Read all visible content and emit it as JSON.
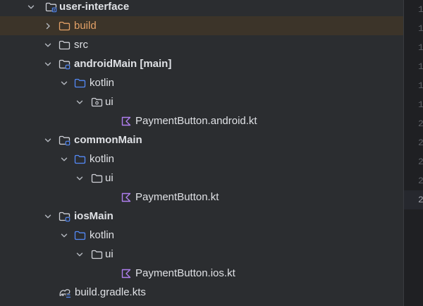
{
  "tree": [
    {
      "id": "user-interface",
      "label": "user-interface",
      "bold": true,
      "depth": 0,
      "chevron": "down",
      "icon": "module-folder"
    },
    {
      "id": "build",
      "label": "build",
      "depth": 1,
      "chevron": "right",
      "icon": "folder-excluded",
      "selected": true,
      "color": "#e3a167"
    },
    {
      "id": "src",
      "label": "src",
      "depth": 1,
      "chevron": "down",
      "icon": "folder"
    },
    {
      "id": "androidMain",
      "label": "androidMain",
      "suffix": "[main]",
      "bold": true,
      "depth": 2,
      "chevron": "down",
      "icon": "source-set-folder"
    },
    {
      "id": "androidMain-kotlin",
      "label": "kotlin",
      "depth": 3,
      "chevron": "down",
      "icon": "source-folder"
    },
    {
      "id": "androidMain-ui",
      "label": "ui",
      "depth": 4,
      "chevron": "down",
      "icon": "package-folder"
    },
    {
      "id": "android-kt",
      "label": "PaymentButton.android.kt",
      "depth": 5,
      "icon": "kotlin-file"
    },
    {
      "id": "commonMain",
      "label": "commonMain",
      "bold": true,
      "depth": 2,
      "chevron": "down",
      "icon": "source-set-folder"
    },
    {
      "id": "commonMain-kotlin",
      "label": "kotlin",
      "depth": 3,
      "chevron": "down",
      "icon": "source-folder"
    },
    {
      "id": "commonMain-ui",
      "label": "ui",
      "depth": 4,
      "chevron": "down",
      "icon": "folder"
    },
    {
      "id": "common-kt",
      "label": "PaymentButton.kt",
      "depth": 5,
      "icon": "kotlin-file"
    },
    {
      "id": "iosMain",
      "label": "iosMain",
      "bold": true,
      "depth": 2,
      "chevron": "down",
      "icon": "source-set-folder"
    },
    {
      "id": "iosMain-kotlin",
      "label": "kotlin",
      "depth": 3,
      "chevron": "down",
      "icon": "source-folder"
    },
    {
      "id": "iosMain-ui",
      "label": "ui",
      "depth": 4,
      "chevron": "down",
      "icon": "folder"
    },
    {
      "id": "ios-kt",
      "label": "PaymentButton.ios.kt",
      "depth": 5,
      "icon": "kotlin-file"
    },
    {
      "id": "build-gradle",
      "label": "build.gradle.kts",
      "depth": 1,
      "icon": "gradle-file"
    }
  ],
  "gutter": {
    "lines": [
      "1",
      "1",
      "1",
      "1",
      "1",
      "1",
      "2",
      "2",
      "2",
      "2",
      "2"
    ],
    "current_index": 10
  }
}
